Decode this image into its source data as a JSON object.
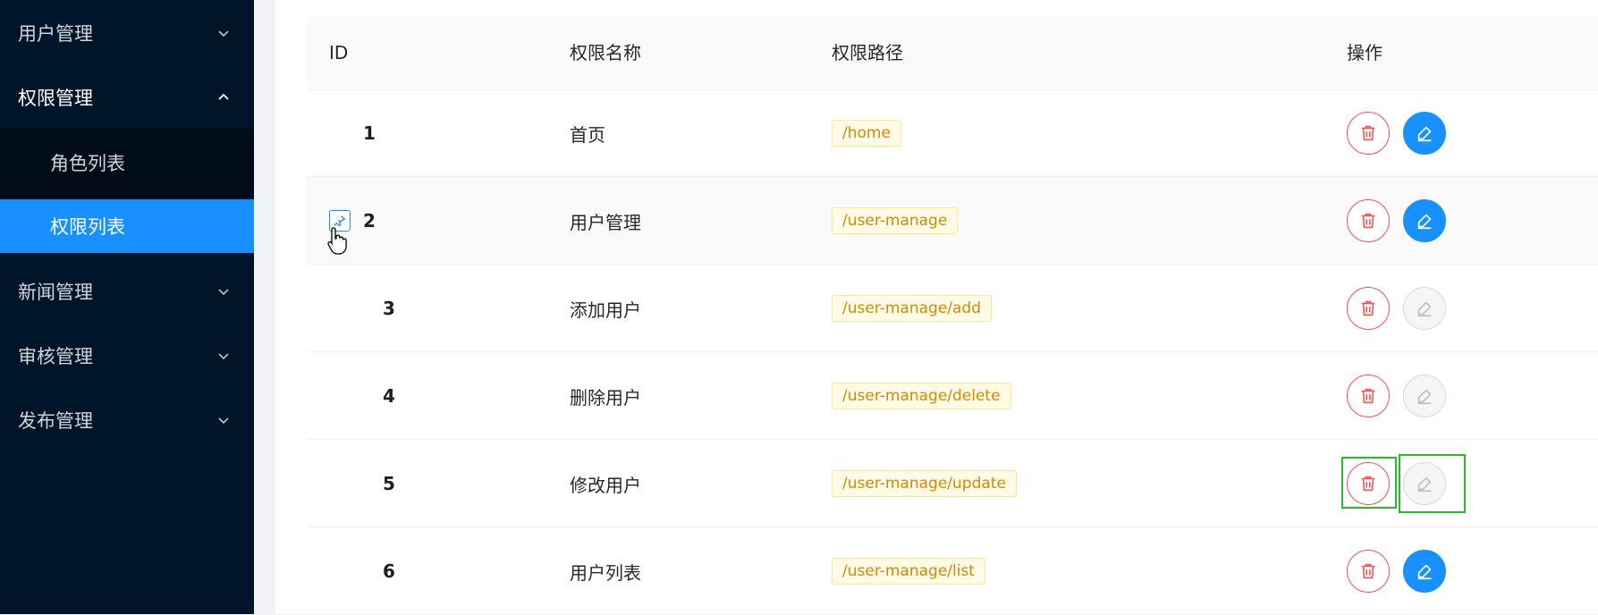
{
  "sidebar": {
    "menus": [
      {
        "label": "用户管理",
        "expanded": false
      },
      {
        "label": "权限管理",
        "expanded": true,
        "children": [
          {
            "label": "角色列表",
            "active": false
          },
          {
            "label": "权限列表",
            "active": true
          }
        ]
      },
      {
        "label": "新闻管理",
        "expanded": false
      },
      {
        "label": "审核管理",
        "expanded": false
      },
      {
        "label": "发布管理",
        "expanded": false
      }
    ]
  },
  "table": {
    "columns": [
      "ID",
      "权限名称",
      "权限路径",
      "操作"
    ],
    "rows": [
      {
        "id": "1",
        "name": "首页",
        "path": "/home",
        "edit_enabled": true
      },
      {
        "id": "2",
        "name": "用户管理",
        "path": "/user-manage",
        "edit_enabled": true,
        "expandable": true
      },
      {
        "id": "3",
        "name": "添加用户",
        "path": "/user-manage/add",
        "edit_enabled": false
      },
      {
        "id": "4",
        "name": "删除用户",
        "path": "/user-manage/delete",
        "edit_enabled": false
      },
      {
        "id": "5",
        "name": "修改用户",
        "path": "/user-manage/update",
        "edit_enabled": false
      },
      {
        "id": "6",
        "name": "用户列表",
        "path": "/user-manage/list",
        "edit_enabled": true
      }
    ]
  },
  "icons": {
    "delete": "trash-icon",
    "edit": "pencil-icon",
    "expand": "pin-icon",
    "chevron_down": "chevron-down-icon",
    "chevron_up": "chevron-up-icon"
  },
  "colors": {
    "sidebar_bg": "#001529",
    "sidebar_sub_bg": "#000c17",
    "active_blue": "#1890ff",
    "danger_red": "#ff4d4f",
    "tag_text": "#d48806",
    "tag_bg": "#fffbe6",
    "tag_border": "#ffe58f"
  }
}
